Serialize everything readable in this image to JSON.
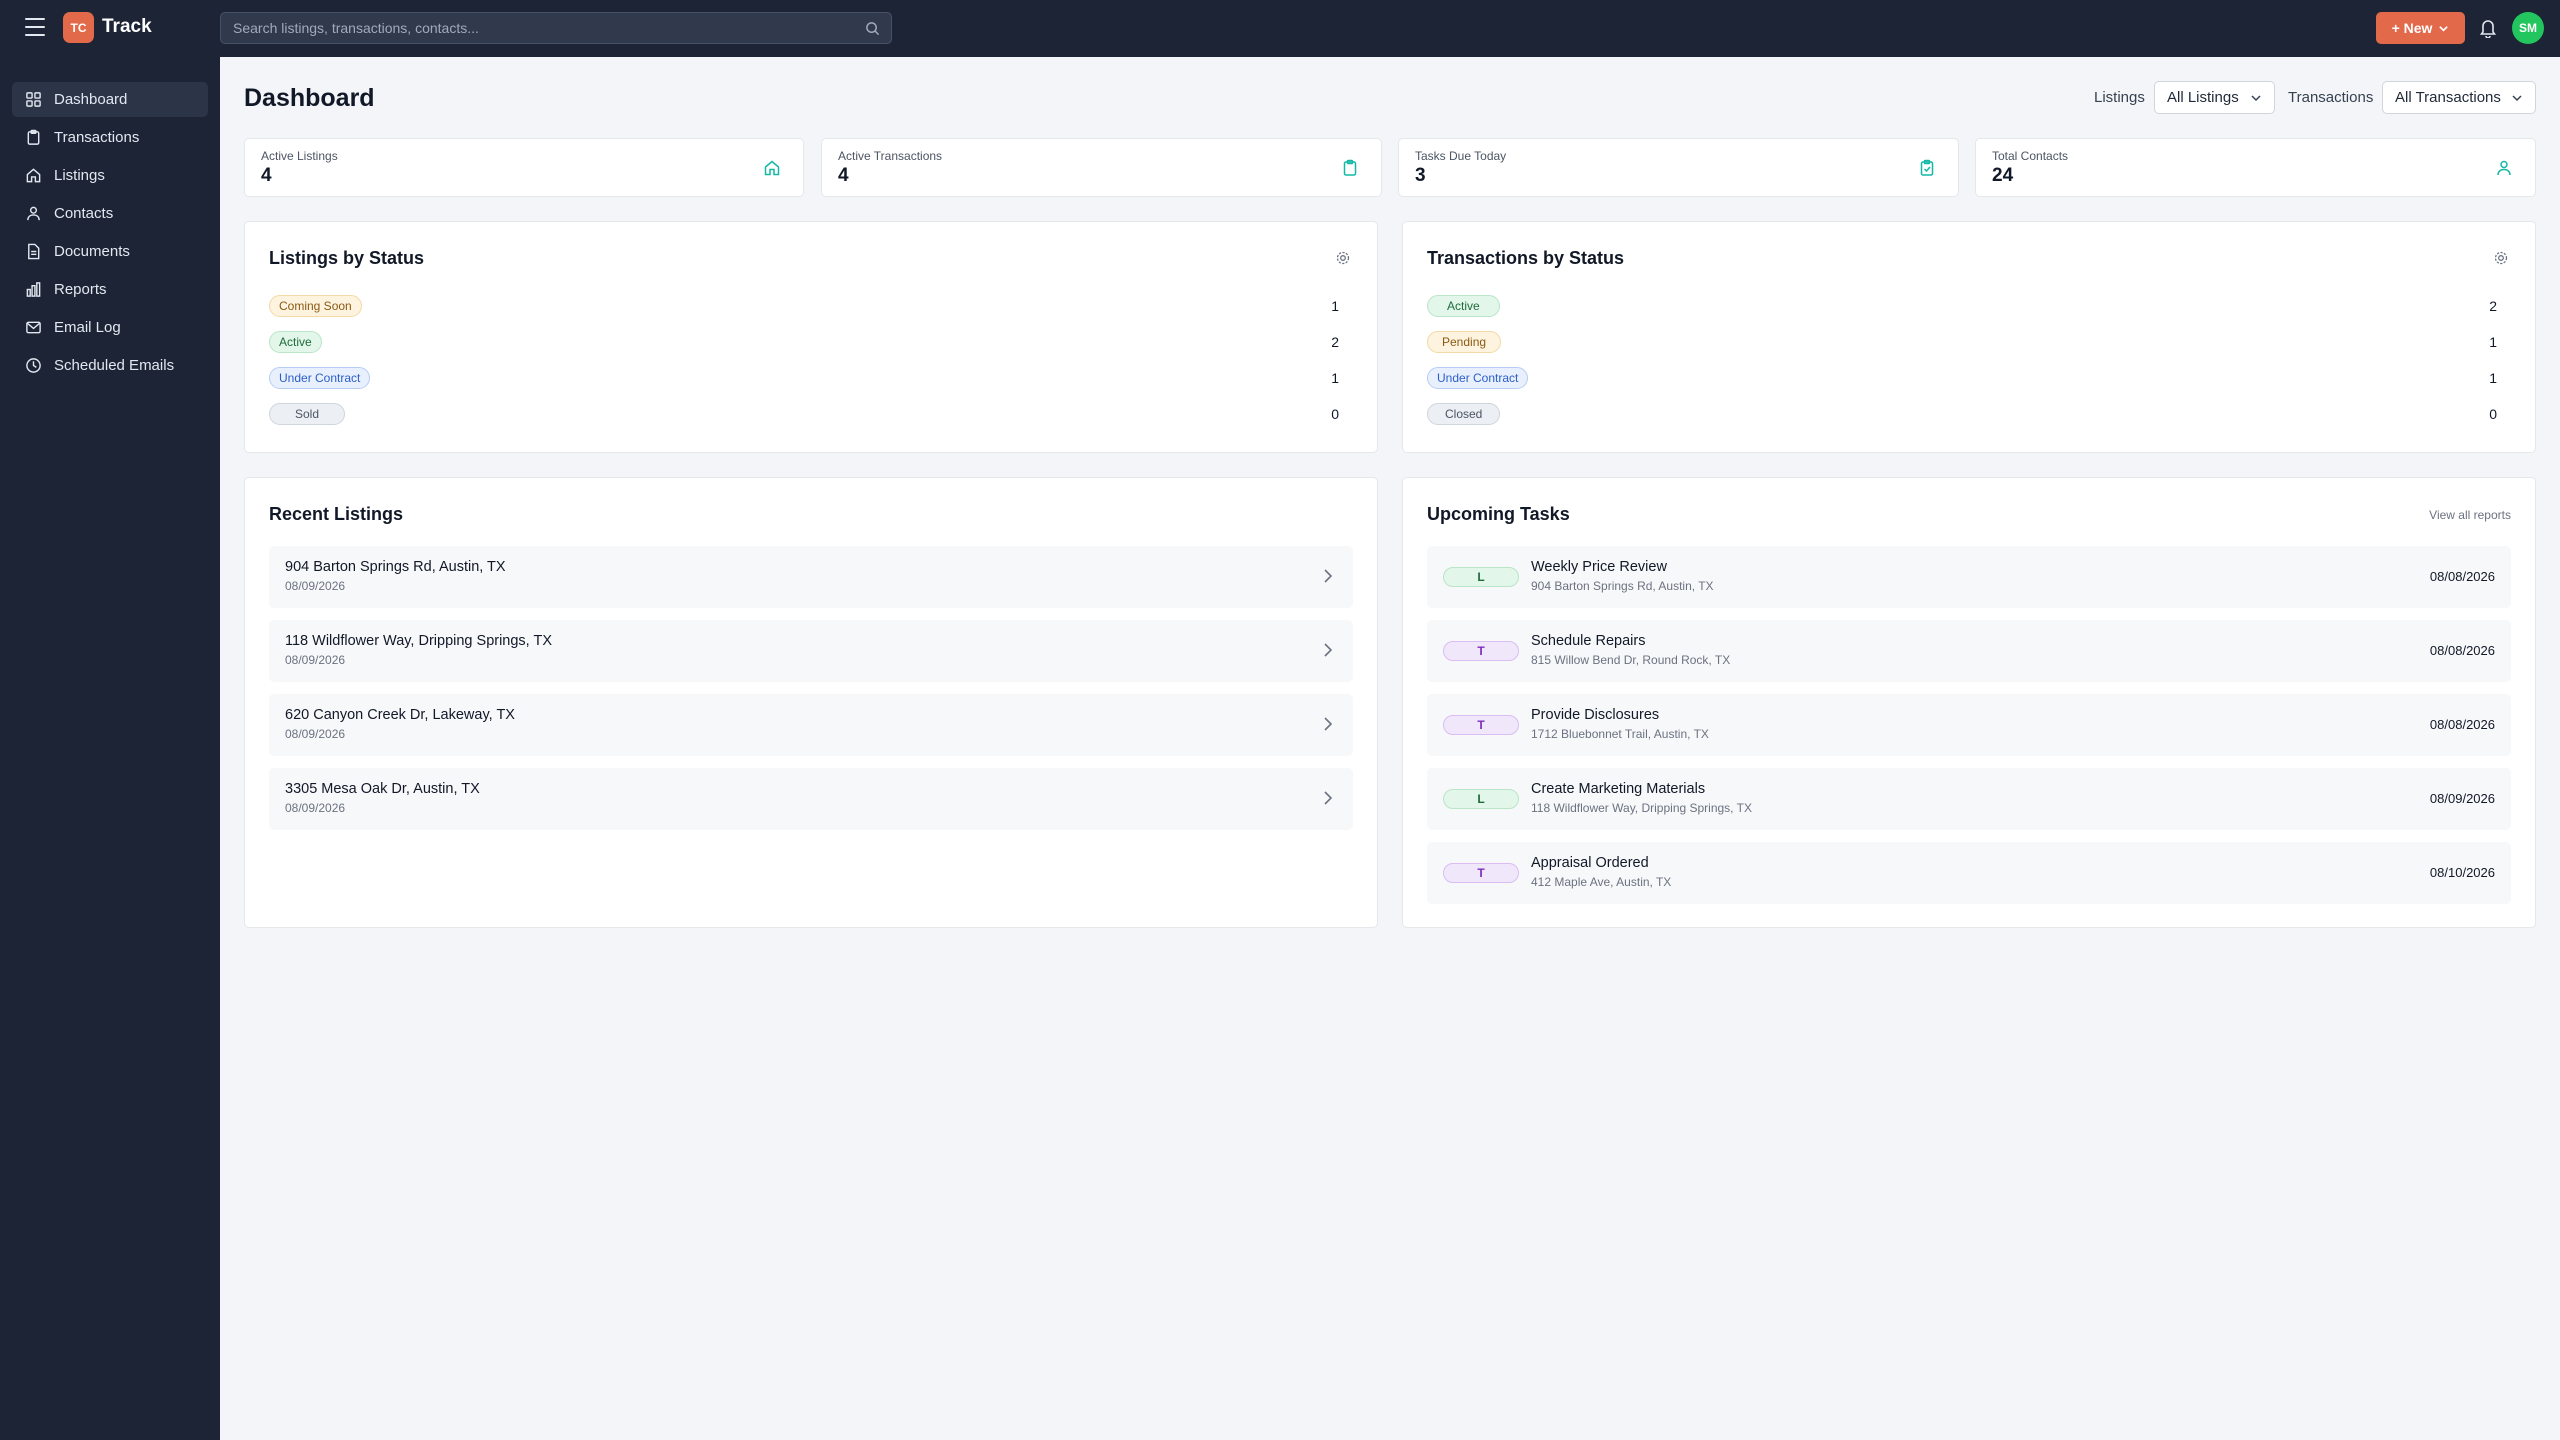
{
  "app": {
    "logo_initials": "TC",
    "name": "Track"
  },
  "search": {
    "placeholder": "Search listings, transactions, contacts..."
  },
  "header": {
    "new_button": "+ New",
    "avatar_initials": "SM"
  },
  "sidebar": {
    "items": [
      {
        "label": "Dashboard",
        "icon": "grid-icon"
      },
      {
        "label": "Transactions",
        "icon": "clipboard-icon"
      },
      {
        "label": "Listings",
        "icon": "home-icon"
      },
      {
        "label": "Contacts",
        "icon": "contacts-icon"
      },
      {
        "label": "Documents",
        "icon": "document-icon"
      },
      {
        "label": "Reports",
        "icon": "bar-chart-icon"
      },
      {
        "label": "Email Log",
        "icon": "mail-icon"
      },
      {
        "label": "Scheduled Emails",
        "icon": "clock-icon"
      }
    ]
  },
  "main": {
    "title": "Dashboard",
    "filters": {
      "listings_label": "Listings",
      "listings_value": "All Listings",
      "transactions_label": "Transactions",
      "transactions_value": "All Transactions"
    },
    "stats": [
      {
        "label": "Active Listings",
        "value": "4"
      },
      {
        "label": "Active Transactions",
        "value": "4"
      },
      {
        "label": "Tasks Due Today",
        "value": "3"
      },
      {
        "label": "Total Contacts",
        "value": "24"
      }
    ],
    "listings_by_status": {
      "title": "Listings by Status",
      "rows": [
        {
          "label": "Coming Soon",
          "count": "1"
        },
        {
          "label": "Active",
          "count": "2"
        },
        {
          "label": "Under Contract",
          "count": "1"
        },
        {
          "label": "Sold",
          "count": "0"
        }
      ]
    },
    "transactions_by_status": {
      "title": "Transactions by Status",
      "rows": [
        {
          "label": "Active",
          "count": "2"
        },
        {
          "label": "Pending",
          "count": "1"
        },
        {
          "label": "Under Contract",
          "count": "1"
        },
        {
          "label": "Closed",
          "count": "0"
        }
      ]
    },
    "recent_listings": {
      "title": "Recent Listings",
      "items": [
        {
          "address": "904 Barton Springs Rd, Austin, TX",
          "date": "08/09/2026"
        },
        {
          "address": "118 Wildflower Way, Dripping Springs, TX",
          "date": "08/09/2026"
        },
        {
          "address": "620 Canyon Creek Dr, Lakeway, TX",
          "date": "08/09/2026"
        },
        {
          "address": "3305 Mesa Oak Dr, Austin, TX",
          "date": "08/09/2026"
        }
      ]
    },
    "upcoming_tasks": {
      "title": "Upcoming Tasks",
      "view_all": "View all reports",
      "items": [
        {
          "badge": "L",
          "title": "Weekly Price Review",
          "address": "904 Barton Springs Rd, Austin, TX",
          "date": "08/08/2026"
        },
        {
          "badge": "T",
          "title": "Schedule Repairs",
          "address": "815 Willow Bend Dr, Round Rock, TX",
          "date": "08/08/2026"
        },
        {
          "badge": "T",
          "title": "Provide Disclosures",
          "address": "1712 Bluebonnet Trail, Austin, TX",
          "date": "08/08/2026"
        },
        {
          "badge": "L",
          "title": "Create Marketing Materials",
          "address": "118 Wildflower Way, Dripping Springs, TX",
          "date": "08/09/2026"
        },
        {
          "badge": "T",
          "title": "Appraisal Ordered",
          "address": "412 Maple Ave, Austin, TX",
          "date": "08/10/2026"
        }
      ]
    }
  },
  "colors": {
    "topbar": "#1c2436",
    "accent": "#e2694a",
    "avatar": "#22c55e",
    "stat_icon": "#14b8a6"
  }
}
